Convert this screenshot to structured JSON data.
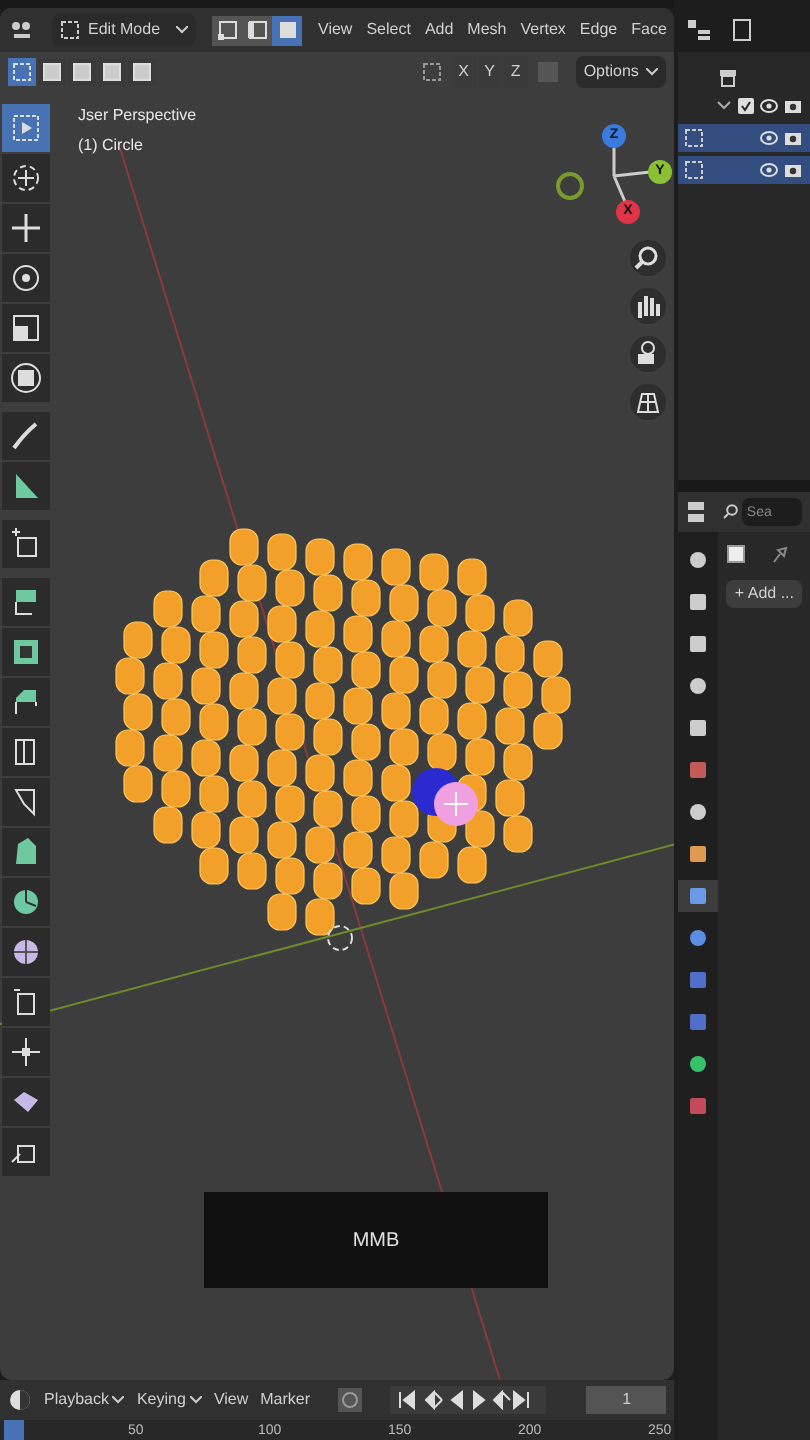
{
  "header": {
    "mode": "Edit Mode",
    "select_modes": [
      {
        "kind": "vertex",
        "selected": false
      },
      {
        "kind": "edge",
        "selected": false
      },
      {
        "kind": "face",
        "selected": true
      }
    ],
    "menus": [
      "View",
      "Select",
      "Add",
      "Mesh",
      "Vertex",
      "Edge",
      "Face"
    ]
  },
  "tool_settings": {
    "select_boxes": [
      {
        "selected": true
      },
      {
        "selected": false
      },
      {
        "selected": false
      },
      {
        "selected": false
      },
      {
        "selected": false
      }
    ],
    "axes": [
      "X",
      "Y",
      "Z"
    ],
    "options": "Options"
  },
  "viewport": {
    "view_name": "Jser Perspective",
    "object_name": "(1) Circle",
    "gizmo": [
      "Z",
      "Y",
      "X"
    ],
    "key_display": "MMB"
  },
  "tools": [
    {
      "kind": "select",
      "selected": true
    },
    {
      "kind": "cursor",
      "selected": false
    },
    {
      "kind": "move",
      "selected": false
    },
    {
      "kind": "rotate",
      "selected": false
    },
    {
      "kind": "scale",
      "selected": false
    },
    {
      "kind": "transform",
      "selected": false
    },
    {
      "kind": "annotate",
      "selected": false
    },
    {
      "kind": "measure",
      "selected": false
    },
    {
      "kind": "addcube",
      "selected": false
    },
    {
      "kind": "extrude",
      "selected": false
    },
    {
      "kind": "inset",
      "selected": false
    },
    {
      "kind": "bevel",
      "selected": false
    },
    {
      "kind": "loopcut",
      "selected": false
    },
    {
      "kind": "knife",
      "selected": false
    },
    {
      "kind": "polybuild",
      "selected": false
    },
    {
      "kind": "spin",
      "selected": false
    },
    {
      "kind": "smooth",
      "selected": false
    },
    {
      "kind": "slide",
      "selected": false
    },
    {
      "kind": "shrink",
      "selected": false
    },
    {
      "kind": "shear",
      "selected": false
    },
    {
      "kind": "rip",
      "selected": false
    }
  ],
  "outliner": {
    "rows": [
      {
        "kind": "collection",
        "checked": true,
        "selected": false
      },
      {
        "kind": "mesh",
        "selected": true
      },
      {
        "kind": "mesh",
        "selected": true
      }
    ]
  },
  "properties": {
    "search": {
      "placeholder": "Sea"
    },
    "add_button": "+ Add ...",
    "tabs": [
      {
        "color": "#cccccc",
        "selected": false
      },
      {
        "color": "#cccccc",
        "selected": false
      },
      {
        "color": "#cccccc",
        "selected": false
      },
      {
        "color": "#cccccc",
        "selected": false
      },
      {
        "color": "#cccccc",
        "selected": false
      },
      {
        "color": "#c25a5a",
        "selected": false
      },
      {
        "color": "#cccccc",
        "selected": false
      },
      {
        "color": "#e09a50",
        "selected": false
      },
      {
        "color": "#6b9be8",
        "selected": true
      },
      {
        "color": "#5a8ee0",
        "selected": false
      },
      {
        "color": "#4e6ec9",
        "selected": false
      },
      {
        "color": "#4e6ec9",
        "selected": false
      },
      {
        "color": "#36c06a",
        "selected": false
      },
      {
        "color": "#c24a5a",
        "selected": false
      }
    ]
  },
  "timeline": {
    "menus": [
      "Playback",
      "Keying",
      "View",
      "Marker"
    ],
    "frame": "1",
    "ruler": [
      "50",
      "100",
      "150",
      "200",
      "250"
    ]
  }
}
